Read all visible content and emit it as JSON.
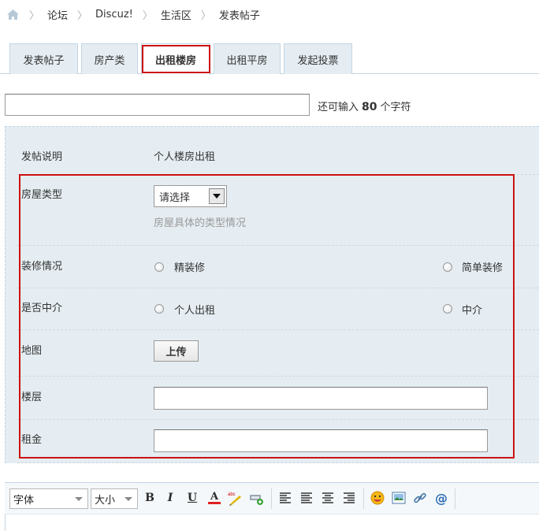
{
  "breadcrumb": {
    "items": [
      "论坛",
      "Discuz!",
      "生活区",
      "发表帖子"
    ],
    "separator": "〉"
  },
  "tabs": [
    {
      "label": "发表帖子",
      "active": false
    },
    {
      "label": "房产类",
      "active": false
    },
    {
      "label": "出租楼房",
      "active": true
    },
    {
      "label": "出租平房",
      "active": false
    },
    {
      "label": "发起投票",
      "active": false
    }
  ],
  "title_field": {
    "value": "",
    "counter_prefix": "还可输入",
    "counter_value": "80",
    "counter_suffix": "个字符"
  },
  "form": {
    "description": {
      "label": "发帖说明",
      "value": "个人楼房出租"
    },
    "house_type": {
      "label": "房屋类型",
      "selected": "请选择",
      "hint": "房屋具体的类型情况"
    },
    "decoration": {
      "label": "装修情况",
      "options": [
        "精装修",
        "简单装修"
      ]
    },
    "agent": {
      "label": "是否中介",
      "options": [
        "个人出租",
        "中介"
      ]
    },
    "map": {
      "label": "地图",
      "button": "上传"
    },
    "floor": {
      "label": "楼层",
      "value": ""
    },
    "rent": {
      "label": "租金",
      "value": ""
    }
  },
  "editor": {
    "font_select": "字体",
    "size_select": "大小",
    "bold": "B",
    "italic": "I",
    "underline": "U",
    "color": "A"
  },
  "colors": {
    "highlight": "#cc1111",
    "panel_bg": "#e5edf2",
    "tab_bg": "#e5edf2",
    "border": "#c2d5e3"
  }
}
